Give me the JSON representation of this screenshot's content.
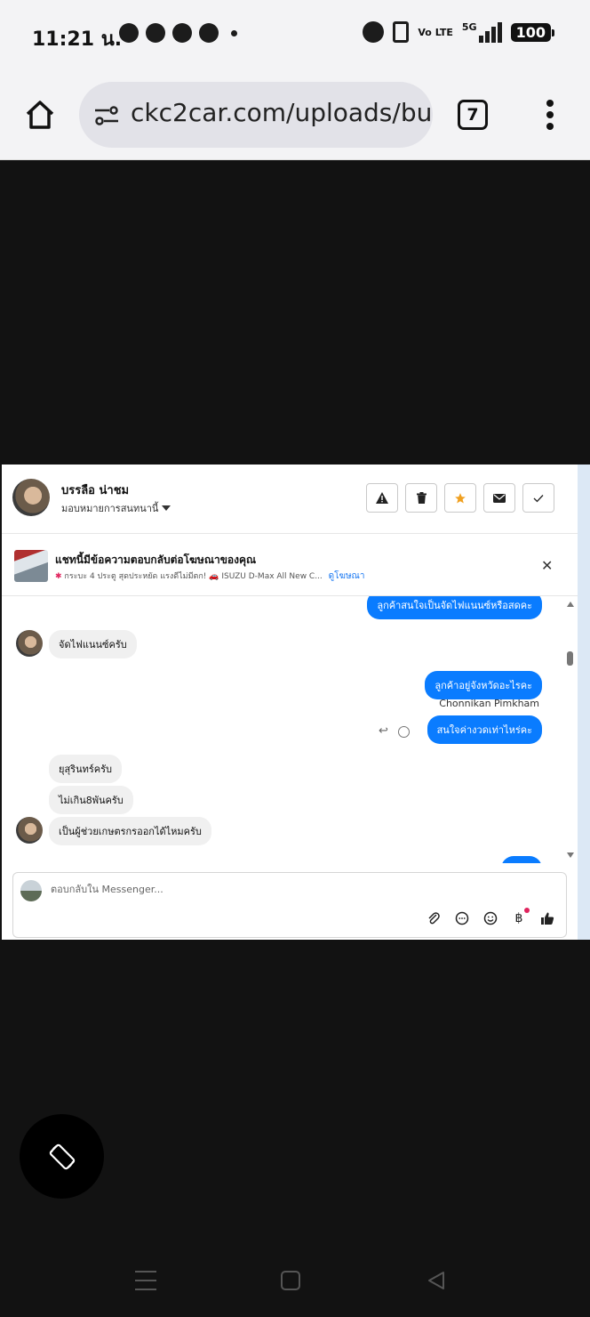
{
  "status_bar": {
    "time": "11:21 น.",
    "network": "5G",
    "volte": "Vo LTE",
    "battery": "100"
  },
  "browser": {
    "url": "ckc2car.com/uploads/bu",
    "tab_count": "7"
  },
  "conversation": {
    "contact_name": "บรรลือ น่าชม",
    "assign_label": "มอบหมายการสนทนานี้",
    "actions": [
      "warning-icon",
      "trash-icon",
      "star-icon",
      "mail-icon",
      "check-icon"
    ]
  },
  "ad_banner": {
    "title": "แชทนี้มีข้อความตอบกลับต่อโฆษณาของคุณ",
    "subtitle": "กระบะ 4 ประตู สุดประหยัด แรงดีไม่มีตก! 🚗 ISUZU D-Max All New C...",
    "link": "ดูโฆษณา"
  },
  "messages": [
    {
      "side": "out",
      "text": "ลูกค้าสนใจเป็นจัดไฟแนนซ์หรือสดคะ"
    },
    {
      "side": "in",
      "text": "จัดไฟแนนซ์ครับ"
    },
    {
      "side": "out",
      "text": "ลูกค้าอยู่จังหวัดอะไรคะ"
    },
    {
      "side": "out",
      "text": "สนใจค่างวดเท่าไหร่คะ",
      "sender": "Chonnikan Pimkham"
    },
    {
      "side": "in",
      "text": "ยุสุรินทร์ครับ"
    },
    {
      "side": "in",
      "text": "ไม่เกิน8พันครับ"
    },
    {
      "side": "in",
      "text": "เป็นผู้ช่วยเกษตรกรออกได้ไหมครับ"
    }
  ],
  "composer": {
    "placeholder": "ตอบกลับใน Messenger..."
  },
  "colors": {
    "messenger_blue": "#0a7cff",
    "incoming_bubble": "#f0f0f0",
    "star": "#f0a020"
  }
}
